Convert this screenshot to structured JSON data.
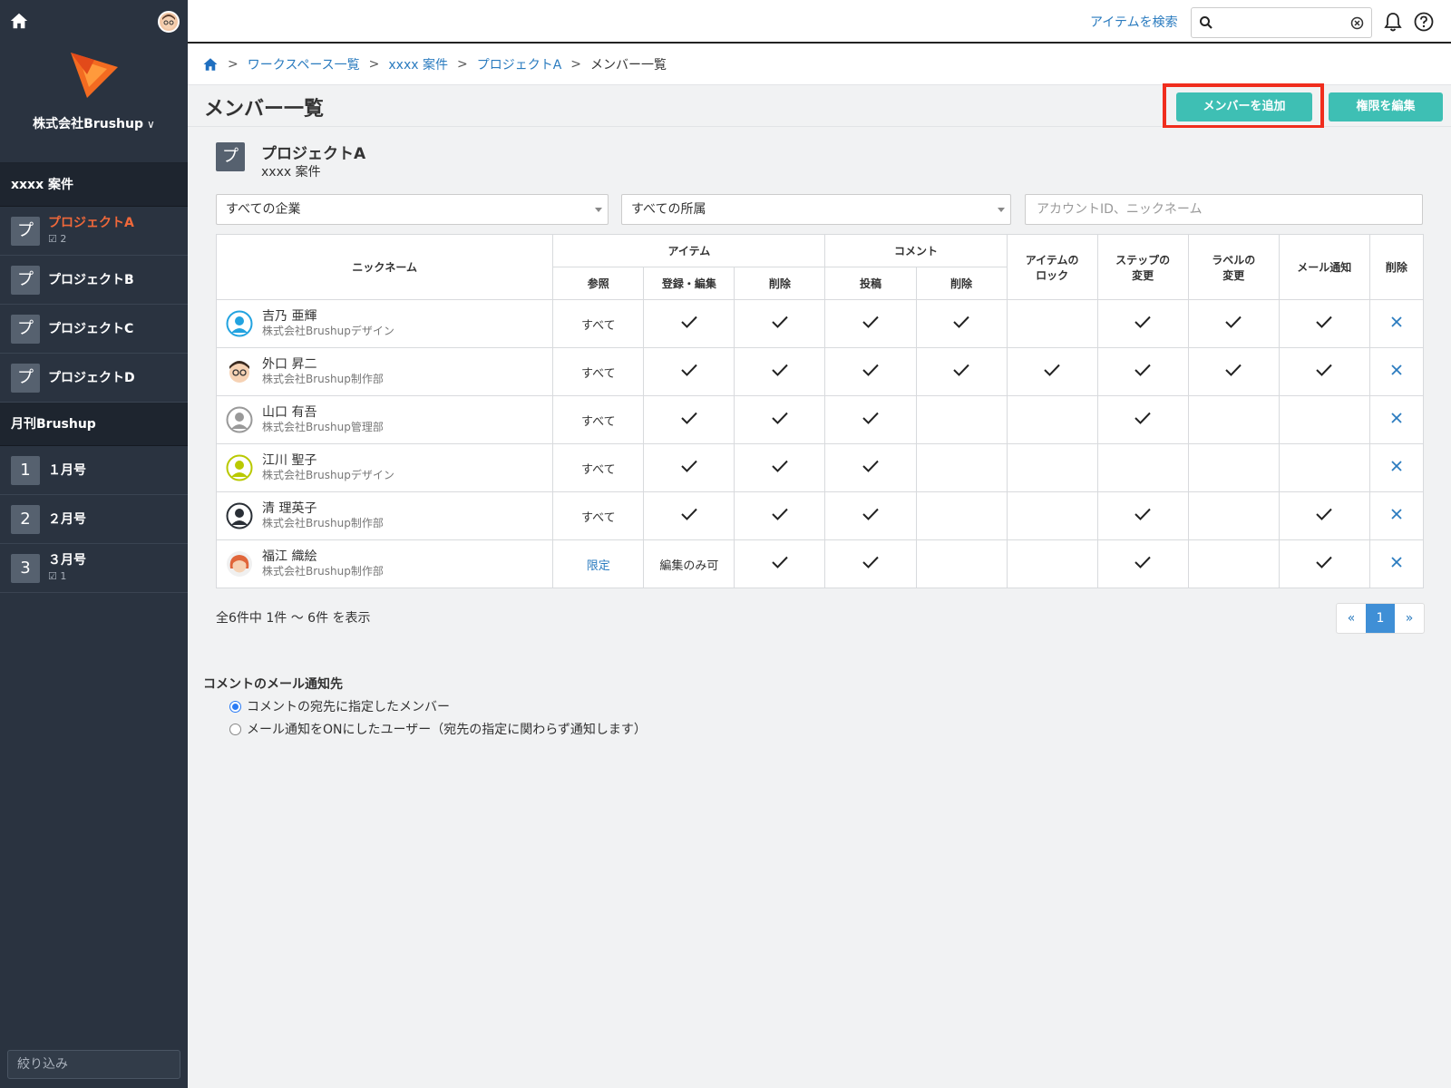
{
  "sidebar": {
    "org_name": "株式会社Brushup",
    "groups": [
      {
        "title": "xxxx 案件",
        "items": [
          {
            "icon": "プ",
            "label": "プロジェクトA",
            "badge": "2",
            "active": true
          },
          {
            "icon": "プ",
            "label": "プロジェクトB"
          },
          {
            "icon": "プ",
            "label": "プロジェクトC"
          },
          {
            "icon": "プ",
            "label": "プロジェクトD"
          }
        ]
      },
      {
        "title": "月刊Brushup",
        "items": [
          {
            "icon": "1",
            "label": "１月号"
          },
          {
            "icon": "2",
            "label": "２月号"
          },
          {
            "icon": "3",
            "label": "３月号",
            "badge": "1"
          }
        ]
      }
    ],
    "filter_placeholder": "絞り込み"
  },
  "header": {
    "search_link": "アイテムを検索",
    "search_value": ""
  },
  "breadcrumb": {
    "items": [
      "ワークスペース一覧",
      "xxxx 案件",
      "プロジェクトA"
    ],
    "current": "メンバー一覧"
  },
  "page": {
    "title": "メンバー一覧",
    "add_member_label": "メンバーを追加",
    "edit_perm_label": "権限を編集"
  },
  "project": {
    "icon": "プ",
    "name": "プロジェクトA",
    "workspace": "xxxx 案件"
  },
  "filters": {
    "company": "すべての企業",
    "department": "すべての所属",
    "search_placeholder": "アカウントID、ニックネーム"
  },
  "table": {
    "headers": {
      "nickname": "ニックネーム",
      "item": "アイテム",
      "comment": "コメント",
      "item_lock": "アイテムの\nロック",
      "step_change": "ステップの\n変更",
      "label_change": "ラベルの\n変更",
      "mail_notify": "メール通知",
      "delete": "削除",
      "ref": "参照",
      "register_edit": "登録・編集",
      "item_delete": "削除",
      "post": "投稿",
      "comment_delete": "削除"
    },
    "rows": [
      {
        "name": "吉乃 亜輝",
        "dept": "株式会社Brushupデザイン",
        "avatar": "blue-person",
        "ref": "すべて",
        "reg": "check",
        "idel": "check",
        "post": "check",
        "cdel": "check",
        "lock": "",
        "step": "check",
        "label": "check",
        "mail": "check"
      },
      {
        "name": "外口 昇二",
        "dept": "株式会社Brushup制作部",
        "avatar": "glasses-man",
        "ref": "すべて",
        "reg": "check",
        "idel": "check",
        "post": "check",
        "cdel": "check",
        "lock": "check",
        "step": "check",
        "label": "check",
        "mail": "check"
      },
      {
        "name": "山口 有吾",
        "dept": "株式会社Brushup管理部",
        "avatar": "gray-person",
        "ref": "すべて",
        "reg": "check",
        "idel": "check",
        "post": "check",
        "cdel": "",
        "lock": "",
        "step": "check",
        "label": "",
        "mail": ""
      },
      {
        "name": "江川 聖子",
        "dept": "株式会社Brushupデザイン",
        "avatar": "green-person",
        "ref": "すべて",
        "reg": "check",
        "idel": "check",
        "post": "check",
        "cdel": "",
        "lock": "",
        "step": "",
        "label": "",
        "mail": ""
      },
      {
        "name": "清 理英子",
        "dept": "株式会社Brushup制作部",
        "avatar": "dark-person",
        "ref": "すべて",
        "reg": "check",
        "idel": "check",
        "post": "check",
        "cdel": "",
        "lock": "",
        "step": "check",
        "label": "",
        "mail": "check"
      },
      {
        "name": "福江 織絵",
        "dept": "株式会社Brushup制作部",
        "avatar": "woman",
        "ref": "限定",
        "ref_link": true,
        "reg": "編集のみ可",
        "idel": "check",
        "post": "check",
        "cdel": "",
        "lock": "",
        "step": "check",
        "label": "",
        "mail": "check"
      }
    ]
  },
  "pagination": {
    "summary": "全6件中 1件 〜 6件 を表示",
    "prev": "«",
    "current": "1",
    "next": "»"
  },
  "notify": {
    "title": "コメントのメール通知先",
    "option1": "コメントの宛先に指定したメンバー",
    "option2": "メール通知をONにしたユーザー（宛先の指定に関わらず通知します）",
    "selected": 1
  },
  "colors": {
    "sidebar_bg": "#2a3340",
    "accent_teal": "#3ebfb4",
    "active_orange": "#f0683a",
    "link_blue": "#2a7bbf",
    "highlight_red": "#f02d1d"
  }
}
